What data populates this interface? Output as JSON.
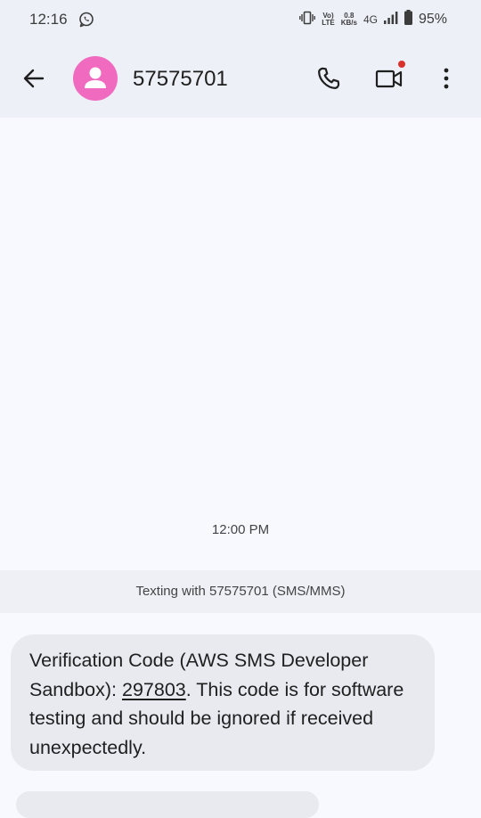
{
  "status_bar": {
    "time": "12:16",
    "volte_top": "Vo)",
    "volte_bottom": "LTE",
    "speed_value": "0.8",
    "speed_unit": "KB/s",
    "network": "4G",
    "battery": "95%"
  },
  "header": {
    "contact_name": "57575701"
  },
  "conversation": {
    "timestamp": "12:00 PM",
    "texting_banner": "Texting with 57575701 (SMS/MMS)",
    "message": {
      "text_before": "Verification Code (AWS SMS Developer Sandbox): ",
      "code": "297803",
      "text_after": ". This code is for software testing and should be ignored if received unexpectedly."
    }
  },
  "colors": {
    "avatar": "#f06bbf",
    "video_badge": "#d9302c",
    "bubble": "#e8eaf0"
  }
}
